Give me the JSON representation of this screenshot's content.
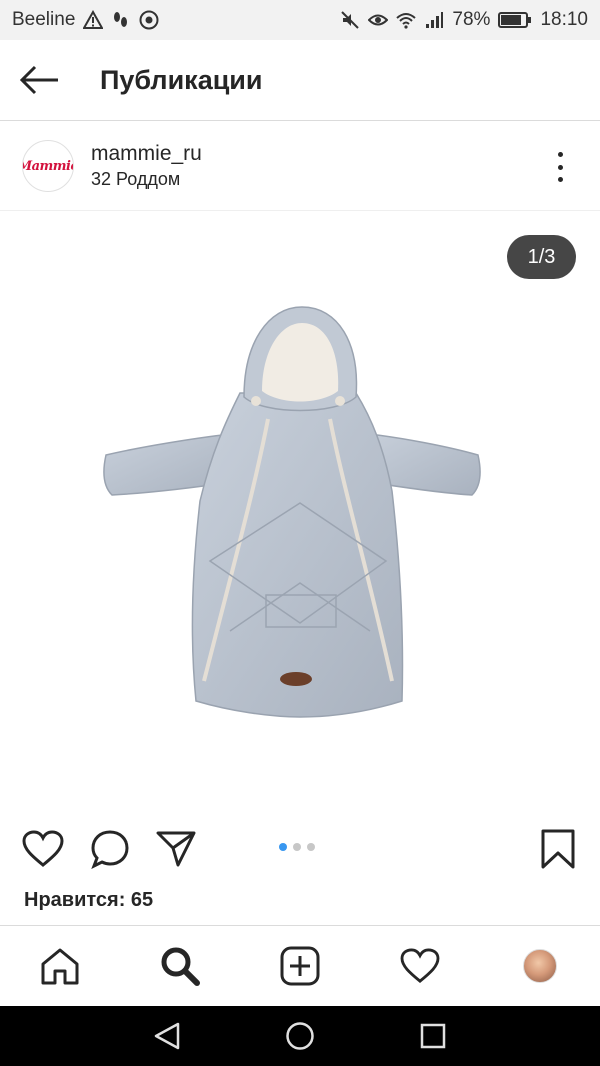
{
  "status_bar": {
    "carrier": "Beeline",
    "battery_percent": "78%",
    "time": "18:10"
  },
  "app_bar": {
    "title": "Публикации"
  },
  "post": {
    "username": "mammie_ru",
    "location": "32 Роддом",
    "avatar_text": "Mammie",
    "image_counter": "1/3",
    "current_slide": 1,
    "total_slides": 3,
    "likes_text": "Нравится: 65"
  },
  "colors": {
    "active_dot": "#3897f0",
    "brand_red": "#d3123d",
    "text": "#262626"
  },
  "icons": {
    "actions": [
      "heart-icon",
      "comment-icon",
      "share-icon",
      "bookmark-icon"
    ],
    "bottom_nav": [
      "home-icon",
      "search-icon",
      "add-icon",
      "activity-heart-icon",
      "profile-avatar"
    ],
    "system_nav": [
      "back-triangle-icon",
      "home-circle-icon",
      "recents-square-icon"
    ]
  }
}
